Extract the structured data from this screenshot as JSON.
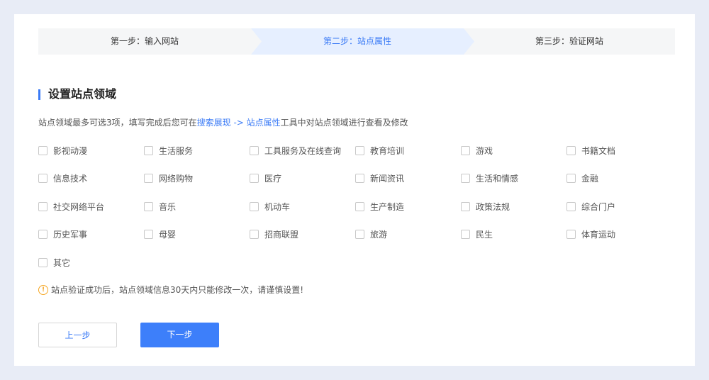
{
  "steps": [
    {
      "label": "第一步：输入网站"
    },
    {
      "label": "第二步：站点属性"
    },
    {
      "label": "第三步：验证网站"
    }
  ],
  "section_title": "设置站点领域",
  "description": {
    "prefix": "站点领域最多可选3项，填写完成后您可在",
    "link": "搜索展现 -> 站点属性",
    "suffix": "工具中对站点领域进行查看及修改"
  },
  "options": [
    [
      "影视动漫",
      "生活服务",
      "工具服务及在线查询",
      "教育培训",
      "游戏",
      "书籍文档"
    ],
    [
      "信息技术",
      "网络购物",
      "医疗",
      "新闻资讯",
      "生活和情感",
      "金融"
    ],
    [
      "社交网络平台",
      "音乐",
      "机动车",
      "生产制造",
      "政策法规",
      "综合门户"
    ],
    [
      "历史军事",
      "母婴",
      "招商联盟",
      "旅游",
      "民生",
      "体育运动"
    ],
    [
      "其它"
    ]
  ],
  "warning_icon": "!",
  "warning": "站点验证成功后，站点领域信息30天内只能修改一次，请谨慎设置!",
  "buttons": {
    "prev": "上一步",
    "next": "下一步"
  },
  "colors": {
    "accent": "#3b7bf6",
    "active_step_bg": "#e6efff",
    "warning": "#f5a623",
    "page_bg": "#e8ecf6"
  }
}
